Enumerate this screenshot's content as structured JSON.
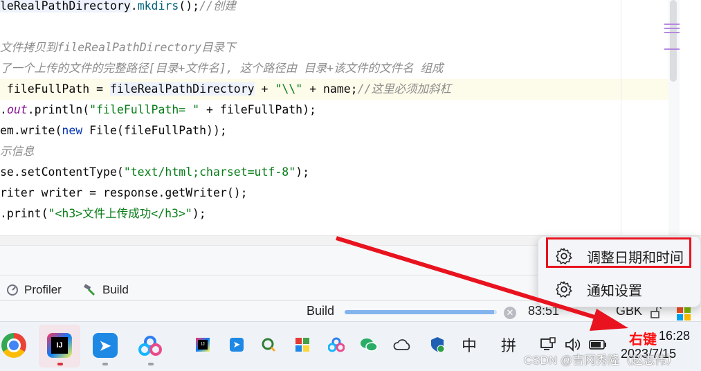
{
  "editor": {
    "lines": [
      {
        "parts": [
          {
            "t": "leRealPathDirectory",
            "c": "t-var"
          },
          {
            "t": ".",
            "c": ""
          },
          {
            "t": "mkdirs",
            "c": "t-method"
          },
          {
            "t": "();",
            "c": ""
          },
          {
            "t": "//创建",
            "c": "t-comment"
          }
        ]
      },
      {
        "parts": []
      },
      {
        "parts": [
          {
            "t": "文件拷贝到fileRealPathDirectory目录下",
            "c": "t-comment"
          }
        ]
      },
      {
        "parts": [
          {
            "t": "了一个上传的文件的完整路径[目录+文件名], 这个路径由 目录+该文件的文件名 组成",
            "c": "t-comment"
          }
        ]
      },
      {
        "parts": [
          {
            "t": " fileFullPath = ",
            "c": ""
          },
          {
            "t": "fileRealPathDirectory",
            "c": "t-var"
          },
          {
            "t": " + ",
            "c": ""
          },
          {
            "t": "\"\\\\\"",
            "c": "t-string"
          },
          {
            "t": " + name;",
            "c": ""
          },
          {
            "t": "//这里必须加斜杠",
            "c": "t-comment"
          }
        ]
      },
      {
        "parts": [
          {
            "t": ".",
            "c": ""
          },
          {
            "t": "out",
            "c": "t-field"
          },
          {
            "t": ".println(",
            "c": ""
          },
          {
            "t": "\"fileFullPath= \"",
            "c": "t-string"
          },
          {
            "t": " + fileFullPath);",
            "c": ""
          }
        ]
      },
      {
        "parts": [
          {
            "t": "em.write(",
            "c": ""
          },
          {
            "t": "new",
            "c": "t-kw"
          },
          {
            "t": " File(fileFullPath));",
            "c": ""
          }
        ]
      },
      {
        "parts": [
          {
            "t": "示信息",
            "c": "t-comment"
          }
        ]
      },
      {
        "parts": [
          {
            "t": "se.setContentType(",
            "c": ""
          },
          {
            "t": "\"text/html;charset=utf-8\"",
            "c": "t-string"
          },
          {
            "t": ");",
            "c": ""
          }
        ]
      },
      {
        "parts": [
          {
            "t": "riter writer = response.getWriter();",
            "c": ""
          }
        ]
      },
      {
        "parts": [
          {
            "t": ".print(",
            "c": ""
          },
          {
            "t": "\"<h3>文件上传成功</h3>\"",
            "c": "t-string"
          },
          {
            "t": ");",
            "c": ""
          }
        ]
      }
    ]
  },
  "tool_windows": {
    "profiler": "Profiler",
    "build": "Build"
  },
  "status_bar": {
    "build_label": "Build",
    "build_progress": 0.98,
    "cursor_pos": "83:51",
    "encoding": "GBK"
  },
  "context_menu": {
    "items": [
      {
        "label": "调整日期和时间"
      },
      {
        "label": "通知设置"
      }
    ]
  },
  "annotation": {
    "text": "右键"
  },
  "taskbar": {
    "tray": {
      "ime_mode": "中",
      "ime_layout": "拼"
    },
    "clock": {
      "time": "16:28",
      "date": "2023/7/15"
    }
  },
  "watermark": "CSDN @吉冈秀隆（赵志伟）",
  "colors": {
    "highlight_red": "#e8131f",
    "arrow_red": "#e8131f",
    "progress_blue": "#84b4ee"
  }
}
